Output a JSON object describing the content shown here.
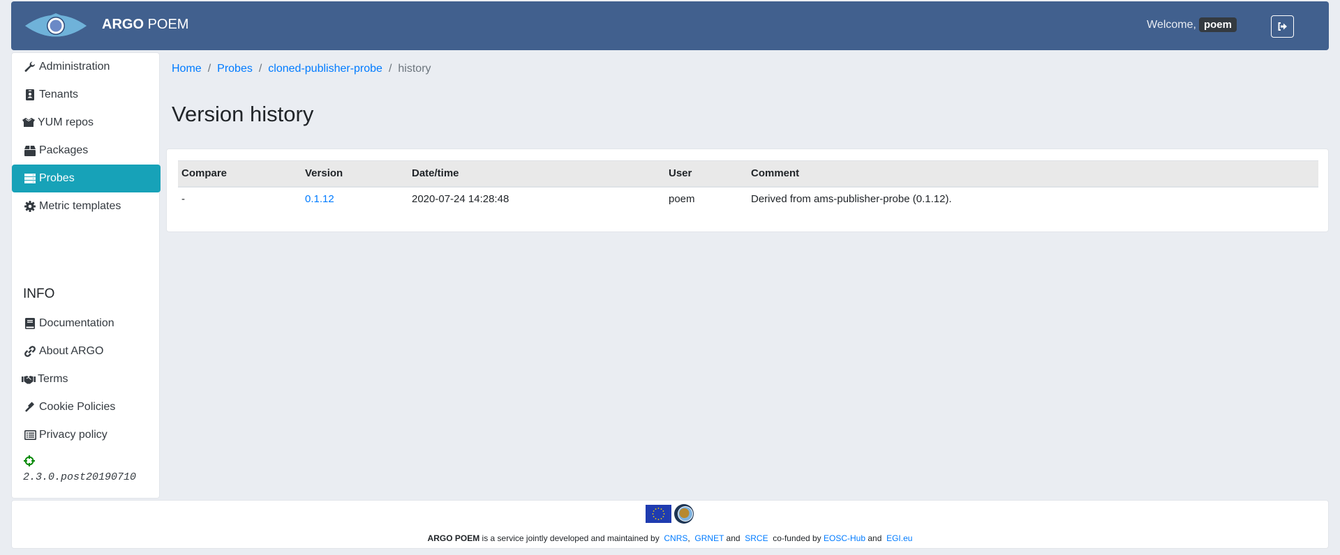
{
  "header": {
    "brand_bold": "ARGO",
    "brand_regular": "POEM",
    "welcome_label": "Welcome,",
    "username": "poem",
    "logout_icon": "sign-out-icon",
    "brand_color": "#41608e"
  },
  "sidebar": {
    "items": [
      {
        "label": "Administration",
        "icon": "wrench-icon",
        "active": false
      },
      {
        "label": "Tenants",
        "icon": "id-badge-icon",
        "active": false
      },
      {
        "label": "YUM repos",
        "icon": "box-open-icon",
        "active": false
      },
      {
        "label": "Packages",
        "icon": "box-icon",
        "active": false
      },
      {
        "label": "Probes",
        "icon": "server-icon",
        "active": true
      },
      {
        "label": "Metric templates",
        "icon": "cog-icon",
        "active": false
      }
    ],
    "active_color": "#17a2b8",
    "info_title": "INFO",
    "info_items": [
      {
        "label": "Documentation",
        "icon": "book-icon"
      },
      {
        "label": "About ARGO",
        "icon": "link-icon"
      },
      {
        "label": "Terms",
        "icon": "handshake-icon"
      },
      {
        "label": "Cookie Policies",
        "icon": "gavel-icon"
      },
      {
        "label": "Privacy policy",
        "icon": "list-alt-icon"
      }
    ],
    "version_icon": "crosshairs-icon",
    "version": "2.3.0.post20190710"
  },
  "breadcrumb": {
    "items": [
      "Home",
      "Probes",
      "cloned-publisher-probe"
    ],
    "current": "history",
    "separator": "/"
  },
  "page_title": "Version history",
  "table": {
    "columns": [
      "Compare",
      "Version",
      "Date/time",
      "User",
      "Comment"
    ],
    "rows": [
      {
        "compare": "-",
        "version": "0.1.12",
        "datetime": "2020-07-24 14:28:48",
        "user": "poem",
        "comment": "Derived from ams-publisher-probe (0.1.12)."
      }
    ]
  },
  "footer": {
    "logos": [
      "eu-flag-icon",
      "egi-logo-icon"
    ],
    "brand": "ARGO POEM",
    "text1": " is a service jointly developed and maintained by ",
    "link_cnrs": "CNRS",
    "comma": ",",
    "link_grnet": "GRNET",
    "and1": " and ",
    "link_srce": "SRCE",
    "text2": " co-funded by ",
    "link_eosc": "EOSC-Hub",
    "and2": " and ",
    "link_egi": "EGI.eu"
  }
}
